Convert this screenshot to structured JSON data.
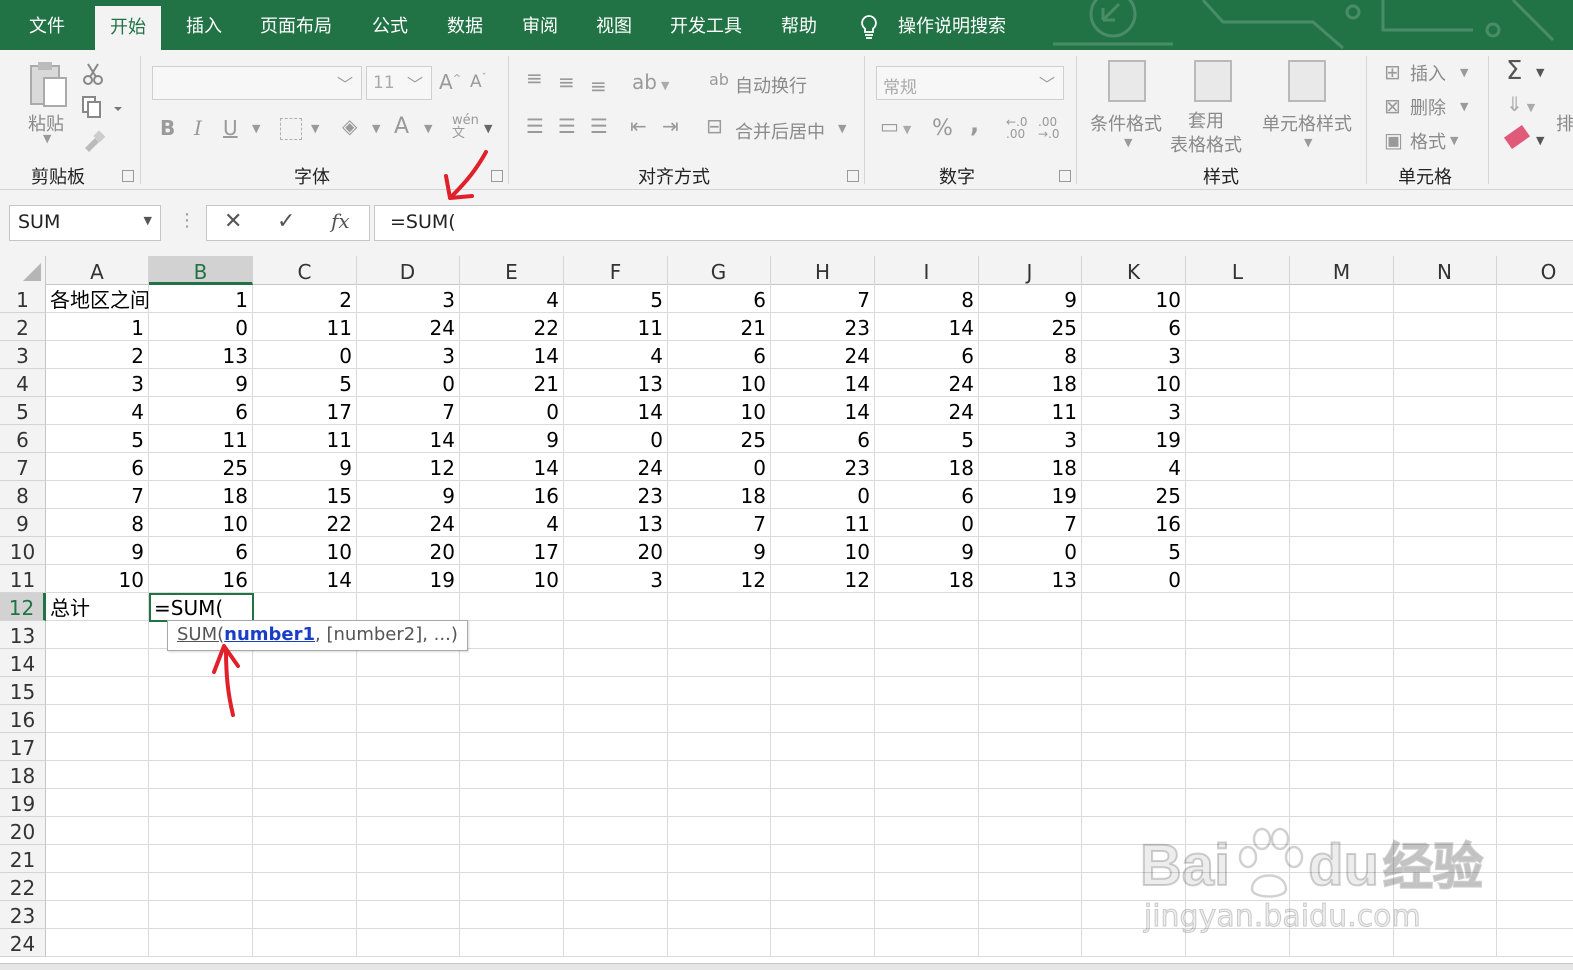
{
  "menu": {
    "tabs": [
      "文件",
      "开始",
      "插入",
      "页面布局",
      "公式",
      "数据",
      "审阅",
      "视图",
      "开发工具",
      "帮助"
    ],
    "active_tab": "开始",
    "search_label": "操作说明搜索"
  },
  "ribbon": {
    "clipboard": {
      "label": "剪贴板",
      "paste": "粘贴"
    },
    "font": {
      "label": "字体",
      "size": "11",
      "bold": "B",
      "italic": "I",
      "underline": "U",
      "font_color": "A",
      "phonetic": "wén\n文"
    },
    "alignment": {
      "label": "对齐方式",
      "wrap_text": "自动换行",
      "merge_center": "合并后居中"
    },
    "number": {
      "label": "数字",
      "format": "常规",
      "percent": "%",
      "comma": ",",
      "inc_decimal": "←.0\n.00",
      "dec_decimal": ".00\n→.0"
    },
    "styles": {
      "label": "样式",
      "conditional": "条件格式",
      "table_format": "套用\n表格格式",
      "cell_styles": "单元格样式"
    },
    "cells": {
      "label": "单元格",
      "insert": "插入",
      "delete": "删除",
      "format": "格式"
    },
    "editing": {
      "sum": "Σ",
      "sort": "排"
    }
  },
  "formula_bar": {
    "name_box": "SUM",
    "formula": "=SUM(",
    "fx": "fx"
  },
  "grid": {
    "columns": [
      "A",
      "B",
      "C",
      "D",
      "E",
      "F",
      "G",
      "H",
      "I",
      "J",
      "K",
      "L",
      "M",
      "N",
      "O"
    ],
    "selected_column": "B",
    "selected_row": 12,
    "rows": [
      [
        "各地区之间",
        "1",
        "2",
        "3",
        "4",
        "5",
        "6",
        "7",
        "8",
        "9",
        "10"
      ],
      [
        "1",
        "0",
        "11",
        "24",
        "22",
        "11",
        "21",
        "23",
        "14",
        "25",
        "6"
      ],
      [
        "2",
        "13",
        "0",
        "3",
        "14",
        "4",
        "6",
        "24",
        "6",
        "8",
        "3"
      ],
      [
        "3",
        "9",
        "5",
        "0",
        "21",
        "13",
        "10",
        "14",
        "24",
        "18",
        "10"
      ],
      [
        "4",
        "6",
        "17",
        "7",
        "0",
        "14",
        "10",
        "14",
        "24",
        "11",
        "3"
      ],
      [
        "5",
        "11",
        "11",
        "14",
        "9",
        "0",
        "25",
        "6",
        "5",
        "3",
        "19"
      ],
      [
        "6",
        "25",
        "9",
        "12",
        "14",
        "24",
        "0",
        "23",
        "18",
        "18",
        "4"
      ],
      [
        "7",
        "18",
        "15",
        "9",
        "16",
        "23",
        "18",
        "0",
        "6",
        "19",
        "25"
      ],
      [
        "8",
        "10",
        "22",
        "24",
        "4",
        "13",
        "7",
        "11",
        "0",
        "7",
        "16"
      ],
      [
        "9",
        "6",
        "10",
        "20",
        "17",
        "20",
        "9",
        "10",
        "9",
        "0",
        "5"
      ],
      [
        "10",
        "16",
        "14",
        "19",
        "10",
        "3",
        "12",
        "12",
        "18",
        "13",
        "0"
      ],
      [
        "总计",
        "=SUM("
      ]
    ],
    "row_numbers": [
      "1",
      "2",
      "3",
      "4",
      "5",
      "6",
      "7",
      "8",
      "9",
      "10",
      "11",
      "12",
      "13",
      "14",
      "15",
      "16",
      "17",
      "18",
      "19",
      "20",
      "21",
      "22",
      "23",
      "24"
    ],
    "tooltip": {
      "fname": "SUM(",
      "arg1": "number1",
      "rest": ", [number2], ...)"
    }
  },
  "colors": {
    "accent": "#217346",
    "annotation": "#e0202a"
  },
  "watermark": {
    "brand": "Bai",
    "brand2": "du",
    "cn": "经验",
    "url": "jingyan.baidu.com"
  }
}
